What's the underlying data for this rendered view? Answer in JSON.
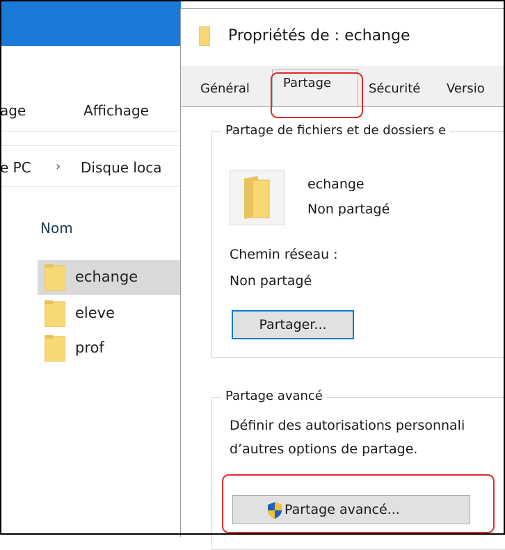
{
  "explorer": {
    "ribbon_tabs": [
      "age",
      "Affichage"
    ],
    "address": {
      "parts": [
        "e PC",
        "Disque loca"
      ],
      "separator": "›"
    },
    "column_header": "Nom",
    "files": [
      {
        "name": "echange",
        "selected": true
      },
      {
        "name": "eleve",
        "selected": false
      },
      {
        "name": "prof",
        "selected": false
      }
    ]
  },
  "dialog": {
    "title": "Propriétés de : echange",
    "tabs": [
      "Général",
      "Partage",
      "Sécurité",
      "Versio"
    ],
    "active_tab": "Partage",
    "sharing_group": {
      "title": "Partage de fichiers et de dossiers e",
      "folder_name": "echange",
      "status": "Non partagé",
      "network_path_label": "Chemin réseau :",
      "network_path_value": "Non partagé",
      "share_button": "Partager..."
    },
    "advanced_group": {
      "title": "Partage avancé",
      "description_line1": "Définir des autorisations personnali",
      "description_line2": "d’autres options de partage.",
      "advanced_button": "Partage avancé..."
    }
  },
  "colors": {
    "titlebar_blue": "#1a7ad9",
    "highlight_red": "#e02a2a",
    "focus_blue": "#0078d7",
    "folder_yellow": "#f8d775"
  }
}
